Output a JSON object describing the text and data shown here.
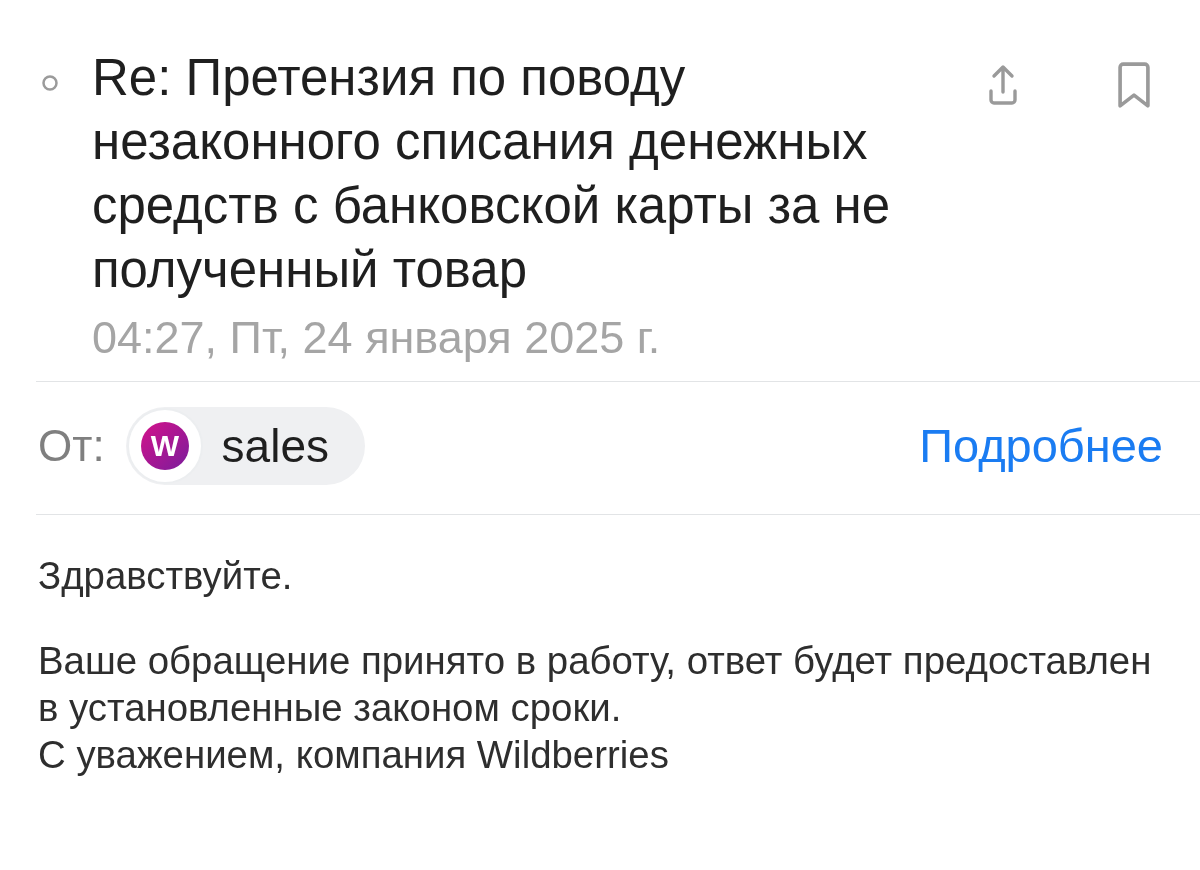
{
  "message": {
    "unread": false,
    "subject": "Re: Претензия по поводу незаконного списания денежных средств с банковской карты за не полученный товар",
    "date": "04:27, Пт, 24 января 2025 г.",
    "bookmarked": false,
    "actions": [
      {
        "kind": "share"
      },
      {
        "kind": "bookmark"
      }
    ]
  },
  "sender": {
    "label": "От:",
    "name": "sales",
    "avatar_letter": "W",
    "details_link": "Подробнее"
  },
  "body": {
    "paragraphs": [
      {
        "lines": [
          "Здравствуйте."
        ]
      },
      {
        "lines": [
          "Ваше обращение принято в работу, ответ будет предоставлен в установленные законом сроки.",
          "С уважением, компания Wildberries"
        ]
      }
    ]
  }
}
